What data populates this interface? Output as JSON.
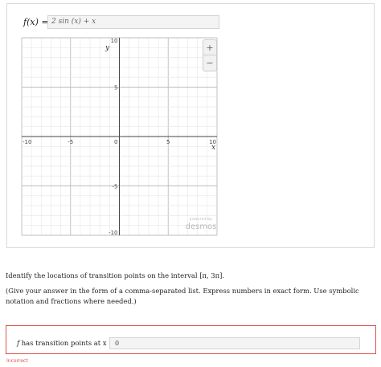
{
  "graph": {
    "function_label": "f(x) =",
    "expression": "2 sin (x) + x",
    "x_axis_label": "x",
    "y_axis_label": "y",
    "x_tick_labels": [
      "-10",
      "-5",
      "0",
      "5",
      "10"
    ],
    "y_tick_labels": [
      "10",
      "5",
      "-5",
      "-10"
    ],
    "zoom_in_label": "+",
    "zoom_out_label": "−",
    "watermark_small": "powered by",
    "watermark_big": "desmos",
    "x_range": [
      -10,
      10
    ],
    "y_range": [
      -10,
      10
    ]
  },
  "question": {
    "text": "Identify the locations of transition points on the interval [π, 3π].",
    "instructions": "(Give your answer in the form of a comma-separated list. Express numbers in exact form. Use symbolic notation and fractions where needed.)"
  },
  "answer": {
    "label_prefix": "f",
    "label_rest": " has transition points at x =",
    "value": "0",
    "status": "Incorrect",
    "status_color": "#d9534f"
  }
}
